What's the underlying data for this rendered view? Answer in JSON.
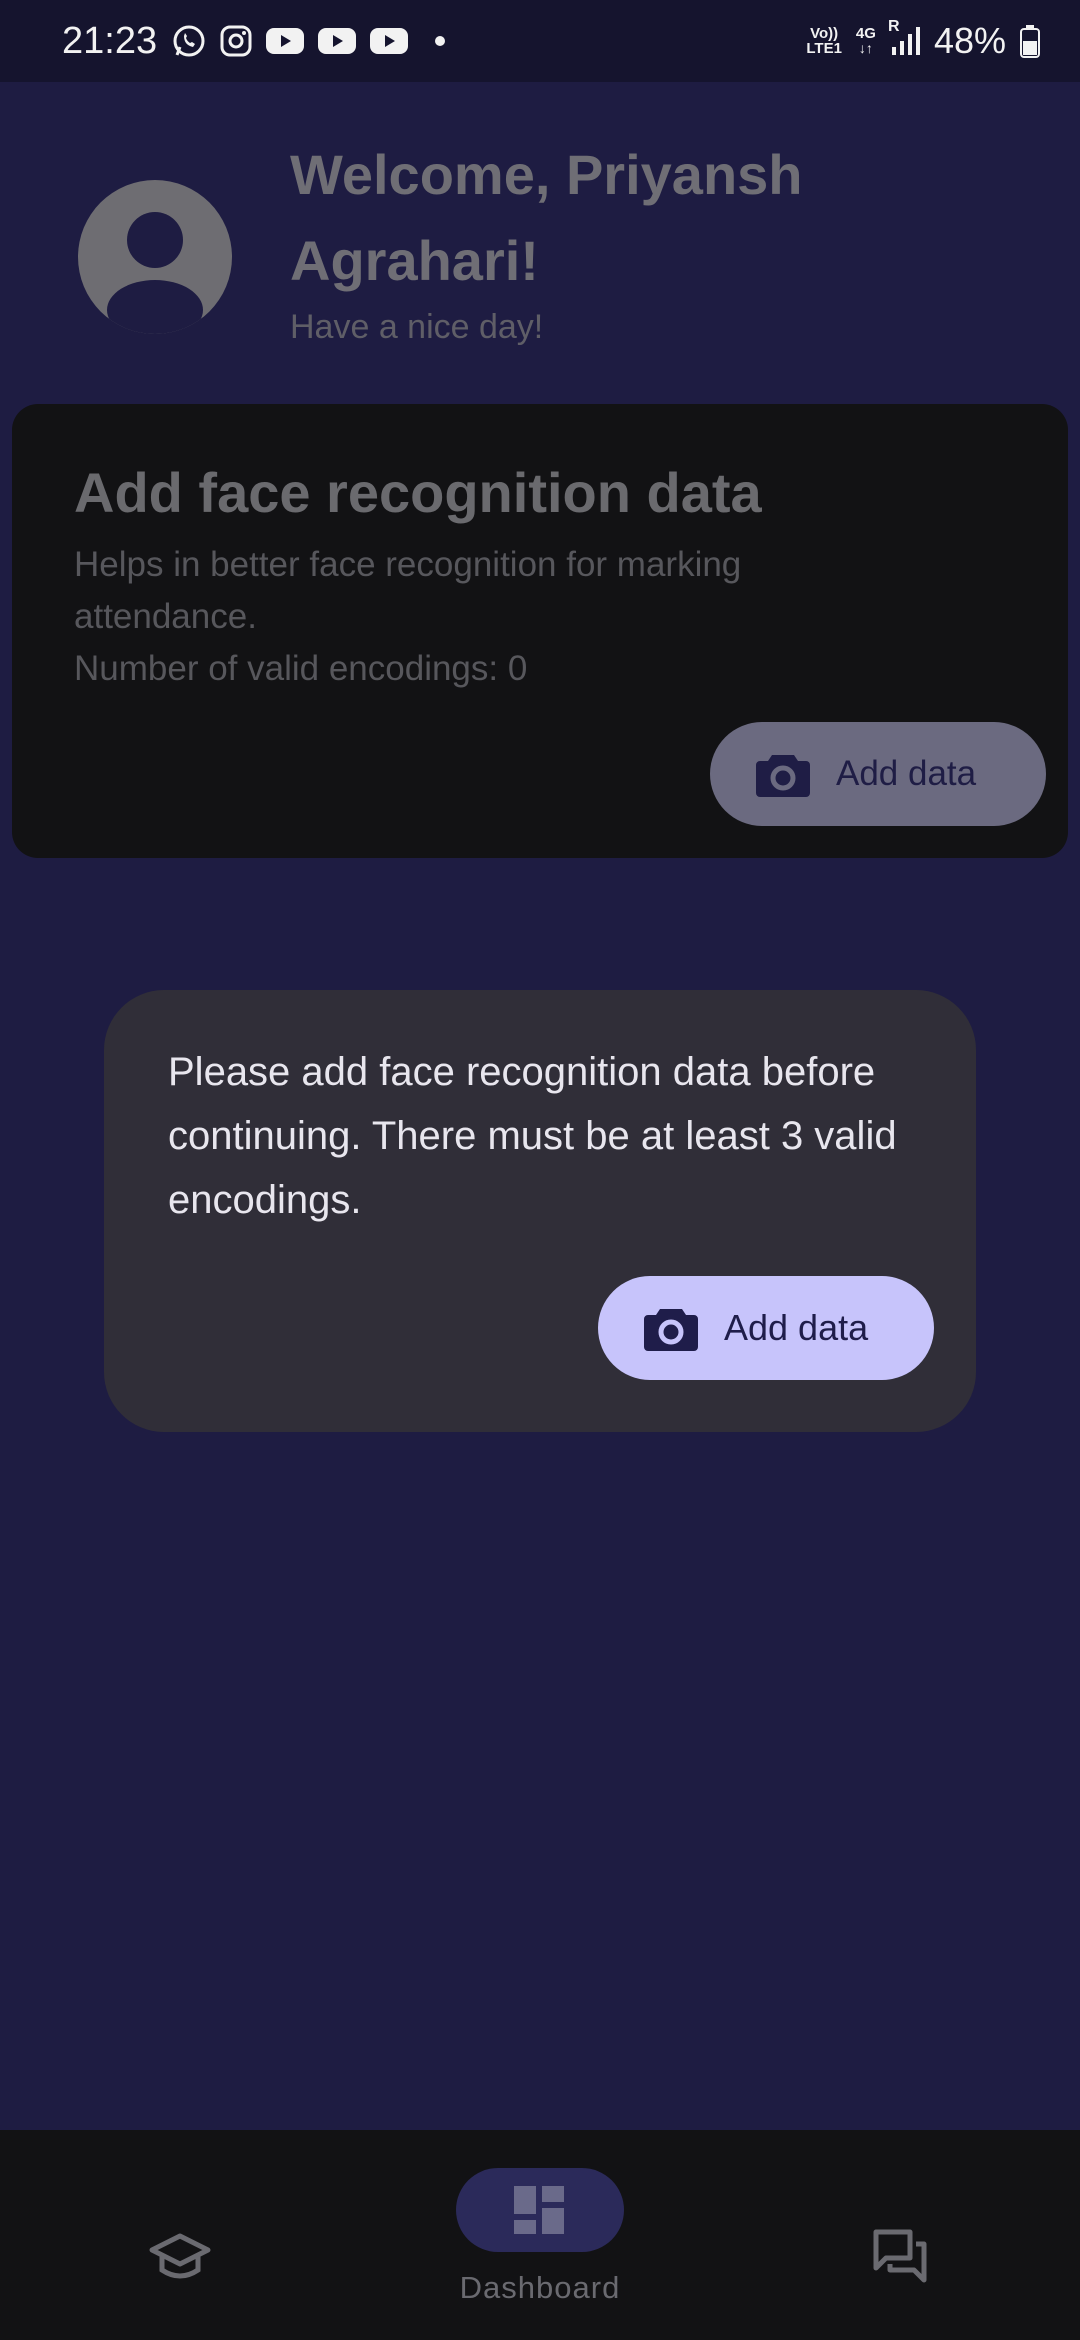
{
  "status_bar": {
    "time": "21:23",
    "network_top": "Vo))",
    "network_bottom": "LTE1",
    "data_type": "4G",
    "roaming": "R",
    "battery": "48%",
    "icons": [
      "whatsapp-icon",
      "instagram-icon",
      "youtube-icon",
      "youtube-icon",
      "youtube-icon"
    ]
  },
  "header": {
    "welcome": "Welcome, Priyansh Agrahari!",
    "subtitle": "Have a nice day!"
  },
  "face_card": {
    "title": "Add face recognition data",
    "description": "Helps in better face recognition for marking attendance.",
    "count": "Number of valid encodings: 0",
    "button_label": "Add data"
  },
  "dialog": {
    "message": "Please add face recognition data before continuing. There must be at least 3 valid encodings.",
    "button_label": "Add data"
  },
  "bottom_nav": {
    "items": [
      {
        "icon": "graduation-cap-icon",
        "label": ""
      },
      {
        "icon": "dashboard-icon",
        "label": "Dashboard"
      },
      {
        "icon": "chat-icon",
        "label": ""
      }
    ]
  },
  "colors": {
    "background": "#1e1c42",
    "dialog": "#302e38",
    "dialog_button": "#c7c4fb",
    "nav_pill": "#2b2a5a"
  }
}
